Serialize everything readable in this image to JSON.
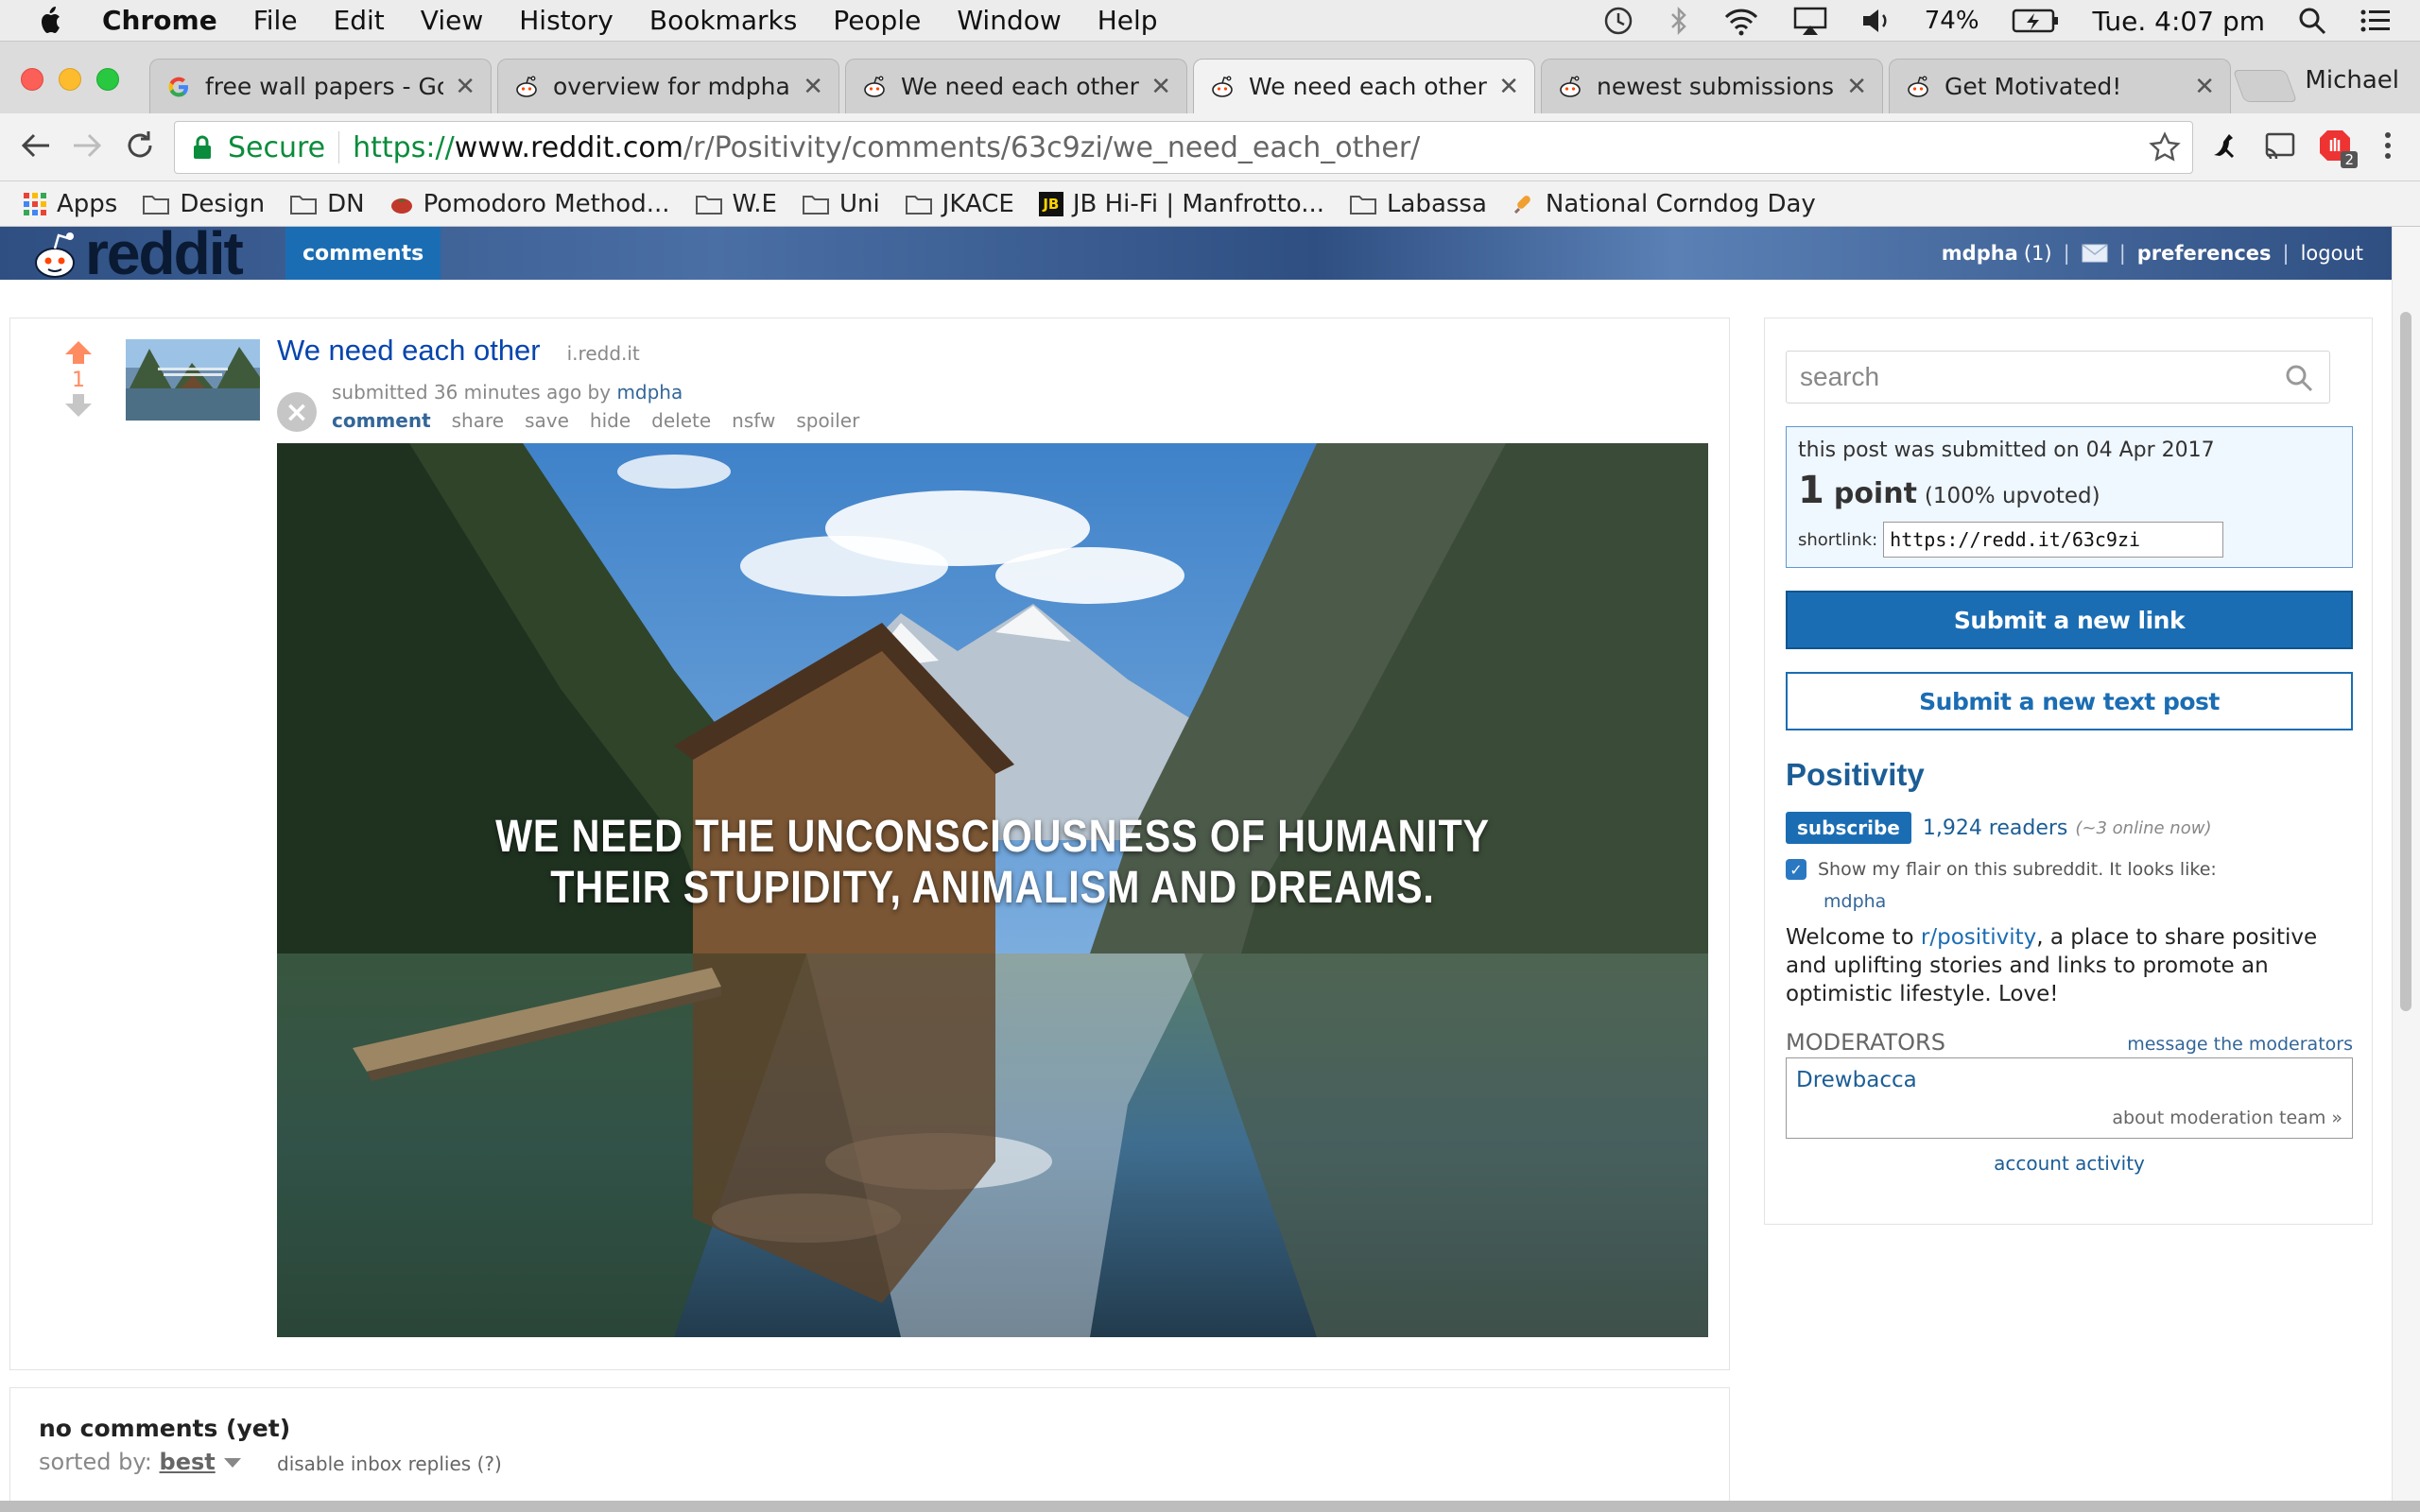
{
  "menubar": {
    "app_name": "Chrome",
    "items": [
      "File",
      "Edit",
      "View",
      "History",
      "Bookmarks",
      "People",
      "Window",
      "Help"
    ],
    "battery": "74%",
    "clock": "Tue. 4:07 pm"
  },
  "tabs": [
    {
      "title": "free wall papers - Goo",
      "favicon": "google-icon",
      "active": false
    },
    {
      "title": "overview for mdpha",
      "favicon": "reddit-icon",
      "active": false
    },
    {
      "title": "We need each other : F",
      "favicon": "reddit-icon",
      "active": false
    },
    {
      "title": "We need each other : F",
      "favicon": "reddit-icon",
      "active": true
    },
    {
      "title": "newest submissions : n",
      "favicon": "reddit-icon",
      "active": false
    },
    {
      "title": "Get Motivated!",
      "favicon": "reddit-icon",
      "active": false
    }
  ],
  "profile_name": "Michael",
  "address": {
    "secure_label": "Secure",
    "scheme": "https://",
    "host": "www.reddit.com",
    "path": "/r/Positivity/comments/63c9zi/we_need_each_other/",
    "extension_badge": "2"
  },
  "bookmarks": [
    {
      "label": "Apps",
      "icon": "apps-grid-icon"
    },
    {
      "label": "Design",
      "icon": "folder-icon"
    },
    {
      "label": "DN",
      "icon": "folder-icon"
    },
    {
      "label": "Pomodoro Method...",
      "icon": "tomato-icon"
    },
    {
      "label": "W.E",
      "icon": "folder-icon"
    },
    {
      "label": "Uni",
      "icon": "folder-icon"
    },
    {
      "label": "JKACE",
      "icon": "folder-icon"
    },
    {
      "label": "JB Hi-Fi | Manfrotto...",
      "icon": "jb-logo-icon",
      "badge": "JB"
    },
    {
      "label": "Labassa",
      "icon": "folder-icon"
    },
    {
      "label": "National Corndog Day",
      "icon": "corndog-icon"
    }
  ],
  "reddit_header": {
    "logo_text": "reddit",
    "tab": "comments",
    "user": "mdpha",
    "karma": "(1)",
    "preferences": "preferences",
    "logout": "logout"
  },
  "post": {
    "score": "1",
    "title": "We need each other",
    "domain": "i.redd.it",
    "tagline_prefix": "submitted 36 minutes ago by",
    "author": "mdpha",
    "remove_icon_glyph": "×",
    "buttons": [
      "comment",
      "share",
      "save",
      "hide",
      "delete",
      "nsfw",
      "spoiler"
    ],
    "image_caption_line1": "WE NEED THE UNCONSCIOUSNESS OF HUMANITY",
    "image_caption_line2": "THEIR STUPIDITY, ANIMALISM AND DREAMS."
  },
  "comments": {
    "heading": "no comments (yet)",
    "sorted_label": "sorted by:",
    "sort_value": "best",
    "disable_replies": "disable inbox replies (?)"
  },
  "sidebar": {
    "search_placeholder": "search",
    "submitted_on": "this post was submitted on 04 Apr 2017",
    "points_num": "1",
    "points_word": "point",
    "upvoted": "(100% upvoted)",
    "shortlink_label": "shortlink:",
    "shortlink_value": "https://redd.it/63c9zi",
    "submit_link": "Submit a new link",
    "submit_text": "Submit a new text post",
    "subreddit_name": "Positivity",
    "subscribe": "subscribe",
    "readers": "1,924 readers",
    "online": "(~3 online now)",
    "flair_label": "Show my flair on this subreddit. It looks like:",
    "flair_user": "mdpha",
    "welcome_prefix": "Welcome to ",
    "welcome_link": "r/positivity",
    "welcome_suffix": ", a place to share positive and uplifting stories and links to promote an optimistic lifestyle. Love!",
    "moderators_title": "MODERATORS",
    "message_moderators": "message the moderators",
    "moderator": "Drewbacca",
    "about_team": "about moderation team »",
    "account_activity": "account activity"
  },
  "colors": {
    "reddit_blue": "#1b6db3",
    "upvote_orange": "#ff8b60",
    "secure_green": "#0a8c3c"
  }
}
